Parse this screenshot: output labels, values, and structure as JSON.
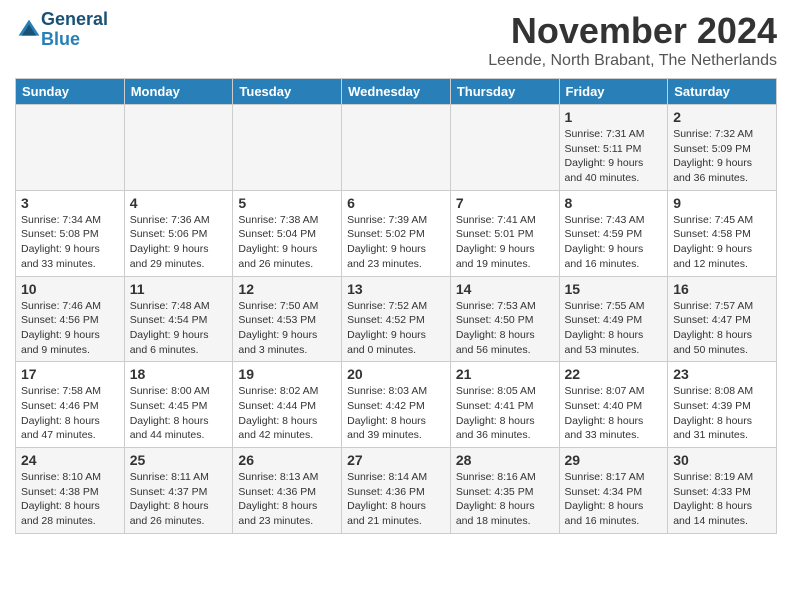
{
  "header": {
    "logo_line1": "General",
    "logo_line2": "Blue",
    "title": "November 2024",
    "subtitle": "Leende, North Brabant, The Netherlands"
  },
  "days_of_week": [
    "Sunday",
    "Monday",
    "Tuesday",
    "Wednesday",
    "Thursday",
    "Friday",
    "Saturday"
  ],
  "weeks": [
    {
      "days": [
        {
          "num": "",
          "info": ""
        },
        {
          "num": "",
          "info": ""
        },
        {
          "num": "",
          "info": ""
        },
        {
          "num": "",
          "info": ""
        },
        {
          "num": "",
          "info": ""
        },
        {
          "num": "1",
          "info": "Sunrise: 7:31 AM\nSunset: 5:11 PM\nDaylight: 9 hours and 40 minutes."
        },
        {
          "num": "2",
          "info": "Sunrise: 7:32 AM\nSunset: 5:09 PM\nDaylight: 9 hours and 36 minutes."
        }
      ]
    },
    {
      "days": [
        {
          "num": "3",
          "info": "Sunrise: 7:34 AM\nSunset: 5:08 PM\nDaylight: 9 hours and 33 minutes."
        },
        {
          "num": "4",
          "info": "Sunrise: 7:36 AM\nSunset: 5:06 PM\nDaylight: 9 hours and 29 minutes."
        },
        {
          "num": "5",
          "info": "Sunrise: 7:38 AM\nSunset: 5:04 PM\nDaylight: 9 hours and 26 minutes."
        },
        {
          "num": "6",
          "info": "Sunrise: 7:39 AM\nSunset: 5:02 PM\nDaylight: 9 hours and 23 minutes."
        },
        {
          "num": "7",
          "info": "Sunrise: 7:41 AM\nSunset: 5:01 PM\nDaylight: 9 hours and 19 minutes."
        },
        {
          "num": "8",
          "info": "Sunrise: 7:43 AM\nSunset: 4:59 PM\nDaylight: 9 hours and 16 minutes."
        },
        {
          "num": "9",
          "info": "Sunrise: 7:45 AM\nSunset: 4:58 PM\nDaylight: 9 hours and 12 minutes."
        }
      ]
    },
    {
      "days": [
        {
          "num": "10",
          "info": "Sunrise: 7:46 AM\nSunset: 4:56 PM\nDaylight: 9 hours and 9 minutes."
        },
        {
          "num": "11",
          "info": "Sunrise: 7:48 AM\nSunset: 4:54 PM\nDaylight: 9 hours and 6 minutes."
        },
        {
          "num": "12",
          "info": "Sunrise: 7:50 AM\nSunset: 4:53 PM\nDaylight: 9 hours and 3 minutes."
        },
        {
          "num": "13",
          "info": "Sunrise: 7:52 AM\nSunset: 4:52 PM\nDaylight: 9 hours and 0 minutes."
        },
        {
          "num": "14",
          "info": "Sunrise: 7:53 AM\nSunset: 4:50 PM\nDaylight: 8 hours and 56 minutes."
        },
        {
          "num": "15",
          "info": "Sunrise: 7:55 AM\nSunset: 4:49 PM\nDaylight: 8 hours and 53 minutes."
        },
        {
          "num": "16",
          "info": "Sunrise: 7:57 AM\nSunset: 4:47 PM\nDaylight: 8 hours and 50 minutes."
        }
      ]
    },
    {
      "days": [
        {
          "num": "17",
          "info": "Sunrise: 7:58 AM\nSunset: 4:46 PM\nDaylight: 8 hours and 47 minutes."
        },
        {
          "num": "18",
          "info": "Sunrise: 8:00 AM\nSunset: 4:45 PM\nDaylight: 8 hours and 44 minutes."
        },
        {
          "num": "19",
          "info": "Sunrise: 8:02 AM\nSunset: 4:44 PM\nDaylight: 8 hours and 42 minutes."
        },
        {
          "num": "20",
          "info": "Sunrise: 8:03 AM\nSunset: 4:42 PM\nDaylight: 8 hours and 39 minutes."
        },
        {
          "num": "21",
          "info": "Sunrise: 8:05 AM\nSunset: 4:41 PM\nDaylight: 8 hours and 36 minutes."
        },
        {
          "num": "22",
          "info": "Sunrise: 8:07 AM\nSunset: 4:40 PM\nDaylight: 8 hours and 33 minutes."
        },
        {
          "num": "23",
          "info": "Sunrise: 8:08 AM\nSunset: 4:39 PM\nDaylight: 8 hours and 31 minutes."
        }
      ]
    },
    {
      "days": [
        {
          "num": "24",
          "info": "Sunrise: 8:10 AM\nSunset: 4:38 PM\nDaylight: 8 hours and 28 minutes."
        },
        {
          "num": "25",
          "info": "Sunrise: 8:11 AM\nSunset: 4:37 PM\nDaylight: 8 hours and 26 minutes."
        },
        {
          "num": "26",
          "info": "Sunrise: 8:13 AM\nSunset: 4:36 PM\nDaylight: 8 hours and 23 minutes."
        },
        {
          "num": "27",
          "info": "Sunrise: 8:14 AM\nSunset: 4:36 PM\nDaylight: 8 hours and 21 minutes."
        },
        {
          "num": "28",
          "info": "Sunrise: 8:16 AM\nSunset: 4:35 PM\nDaylight: 8 hours and 18 minutes."
        },
        {
          "num": "29",
          "info": "Sunrise: 8:17 AM\nSunset: 4:34 PM\nDaylight: 8 hours and 16 minutes."
        },
        {
          "num": "30",
          "info": "Sunrise: 8:19 AM\nSunset: 4:33 PM\nDaylight: 8 hours and 14 minutes."
        }
      ]
    }
  ]
}
